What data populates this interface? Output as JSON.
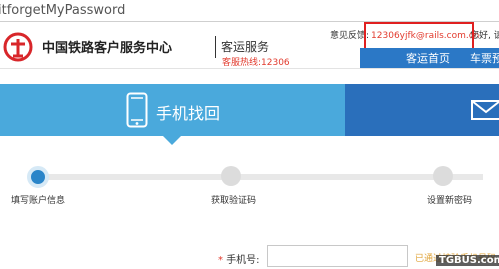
{
  "browser": {
    "url_fragment": "itforgetMyPassword"
  },
  "header": {
    "logo_text": "中国铁路客户服务中心",
    "logo_sub": "客运服务",
    "hotline": "客服热线:12306",
    "feedback_label": "意见反馈:",
    "feedback_email": "12306yjfk@rails.com.cn",
    "greeting": "您好, 请",
    "nav": [
      "客运首页",
      "车票预订"
    ]
  },
  "banner": {
    "active_tab": "手机找回",
    "colors": {
      "active": "#4aa9dc",
      "inactive": "#2a6fbb"
    }
  },
  "steps": [
    "填写账户信息",
    "获取验证码",
    "设置新密码"
  ],
  "form": {
    "phone_label": "手机号:",
    "required_mark": "*",
    "phone_value": "",
    "side_note": "已通过核验手机号码"
  },
  "watermark": "TGBUS.com"
}
